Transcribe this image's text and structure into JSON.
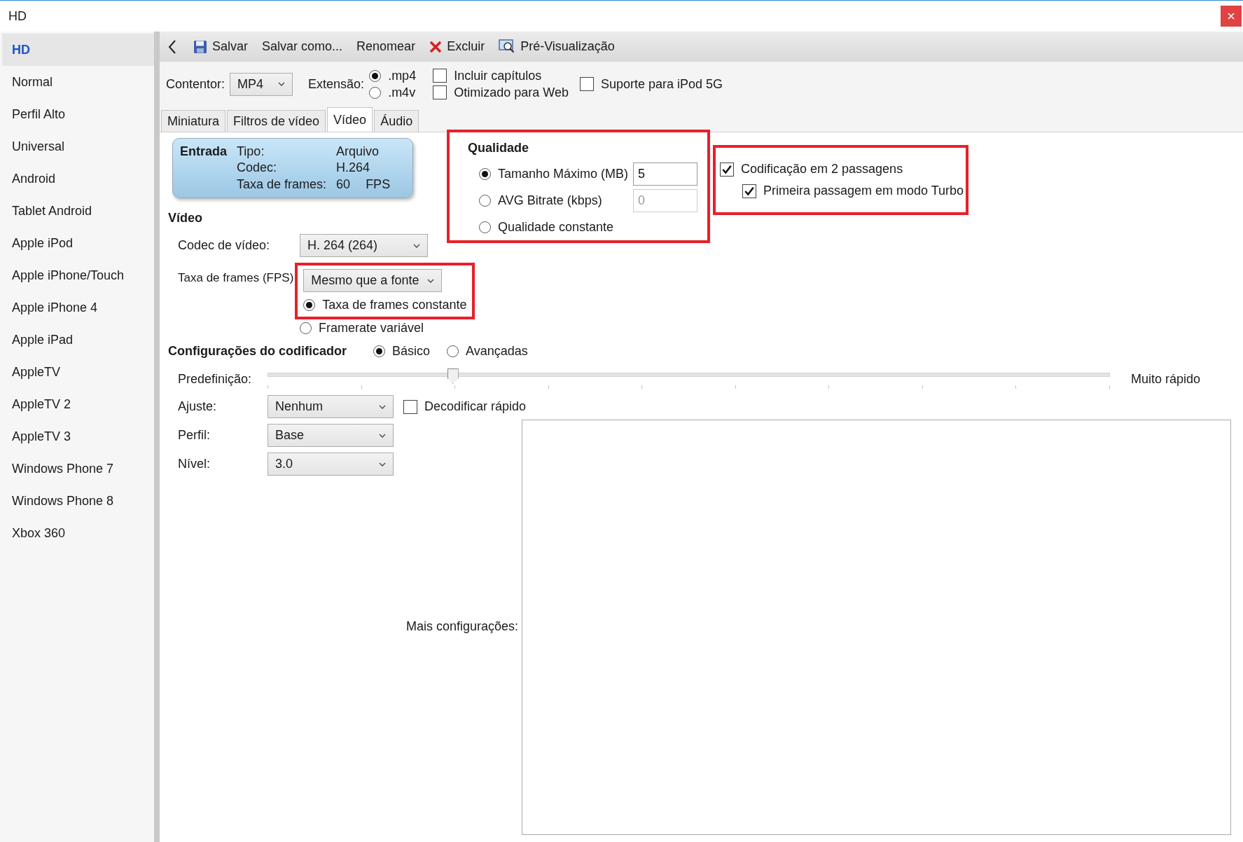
{
  "window": {
    "title": "HD"
  },
  "sidebar": {
    "items": [
      {
        "label": "HD",
        "selected": true
      },
      {
        "label": "Normal",
        "selected": false
      },
      {
        "label": "Perfil Alto",
        "selected": false
      },
      {
        "label": "Universal",
        "selected": false
      },
      {
        "label": "Android",
        "selected": false
      },
      {
        "label": "Tablet Android",
        "selected": false
      },
      {
        "label": "Apple iPod",
        "selected": false
      },
      {
        "label": "Apple iPhone/Touch",
        "selected": false
      },
      {
        "label": "Apple iPhone 4",
        "selected": false
      },
      {
        "label": "Apple iPad",
        "selected": false
      },
      {
        "label": "AppleTV",
        "selected": false
      },
      {
        "label": "AppleTV 2",
        "selected": false
      },
      {
        "label": "AppleTV 3",
        "selected": false
      },
      {
        "label": "Windows Phone 7",
        "selected": false
      },
      {
        "label": "Windows Phone 8",
        "selected": false
      },
      {
        "label": "Xbox 360",
        "selected": false
      }
    ]
  },
  "toolbar": {
    "buttons": [
      {
        "kind": "back"
      },
      {
        "kind": "save",
        "label": "Salvar"
      },
      {
        "kind": "plain",
        "label": "Salvar como..."
      },
      {
        "kind": "plain",
        "label": "Renomear"
      },
      {
        "kind": "delete",
        "label": "Excluir"
      },
      {
        "kind": "preview",
        "label": "Pré-Visualização"
      }
    ]
  },
  "container": {
    "label": "Contentor:",
    "value": "MP4"
  },
  "extension": {
    "label": "Extensão:",
    "options": [
      {
        "label": ".mp4",
        "selected": true
      },
      {
        "label": ".m4v",
        "selected": false
      }
    ]
  },
  "options": [
    {
      "label": "Incluir capítulos",
      "checked": false
    },
    {
      "label": "Otimizado para Web",
      "checked": false
    },
    {
      "label": "Suporte para iPod 5G",
      "checked": false
    }
  ],
  "tabs": [
    {
      "label": "Miniatura",
      "selected": false
    },
    {
      "label": "Filtros de vídeo",
      "selected": false
    },
    {
      "label": "Vídeo",
      "selected": true
    },
    {
      "label": "Áudio",
      "selected": false
    }
  ],
  "input_info": {
    "title": "Entrada",
    "rows": [
      {
        "label": "Tipo:",
        "value": "Arquivo"
      },
      {
        "label": "Codec:",
        "value": "H.264"
      },
      {
        "label": "Taxa de frames:",
        "value": "60",
        "unit": "FPS"
      }
    ]
  },
  "video": {
    "heading": "Vídeo",
    "codec": {
      "label": "Codec de vídeo:",
      "value": "H. 264 (264)"
    },
    "framerate": {
      "label": "Taxa de frames (FPS)",
      "value": "Mesmo que a fonte",
      "modes": [
        {
          "label": "Taxa de frames constante",
          "selected": true
        },
        {
          "label": "Framerate variável",
          "selected": false
        }
      ]
    }
  },
  "quality": {
    "heading": "Qualidade",
    "options": [
      {
        "label": "Tamanho Máximo (MB)",
        "selected": true,
        "value": "5"
      },
      {
        "label": "AVG Bitrate (kbps)",
        "selected": false,
        "value": "0"
      },
      {
        "label": "Qualidade constante",
        "selected": false
      }
    ]
  },
  "two_pass": [
    {
      "label": "Codificação em 2 passagens",
      "checked": true
    },
    {
      "label": "Primeira passagem em modo Turbo",
      "checked": true
    }
  ],
  "encoder": {
    "heading": "Configurações do codificador",
    "modes": [
      {
        "label": "Básico",
        "selected": true
      },
      {
        "label": "Avançadas",
        "selected": false
      }
    ],
    "preset": {
      "label": "Predefinição:",
      "level": 0.22,
      "value_label": "Muito rápido"
    },
    "tune": {
      "label": "Ajuste:",
      "value": "Nenhum"
    },
    "fast_decode": {
      "label": "Decodificar rápido",
      "checked": false
    },
    "profile": {
      "label": "Perfil:",
      "value": "Base"
    },
    "h264_level": {
      "label": "Nível:",
      "value": "3.0"
    },
    "more": {
      "label": "Mais configurações:"
    }
  }
}
